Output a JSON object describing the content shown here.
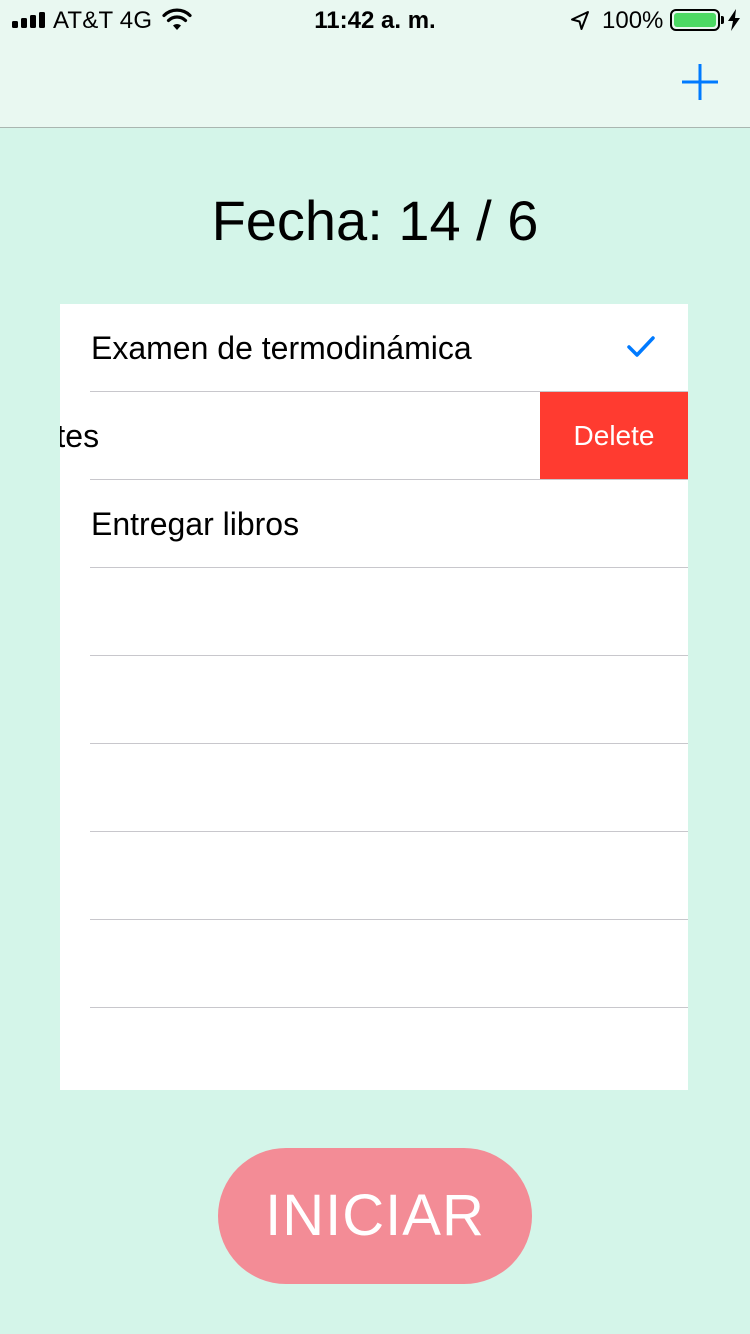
{
  "status_bar": {
    "carrier": "AT&T 4G",
    "time": "11:42 a. m.",
    "battery_percent": "100%",
    "battery_level": 1.0,
    "signal_bars": 4,
    "icons": [
      "signal-icon",
      "wifi-icon",
      "location-arrow-icon",
      "battery-icon",
      "charging-bolt-icon"
    ]
  },
  "nav": {
    "add_icon": "plus-icon",
    "accent_color": "#007aff"
  },
  "header": {
    "title": "Fecha: 14 / 6"
  },
  "tasks": [
    {
      "label": "Examen de termodinámica",
      "checked": true
    },
    {
      "label": "puntes",
      "checked": false,
      "swiped": true
    },
    {
      "label": "Entregar libros",
      "checked": false
    }
  ],
  "row_actions": {
    "delete_label": "Delete",
    "delete_color": "#ff3b30"
  },
  "start_button": {
    "label": "INICIAR",
    "color": "#f38c96"
  },
  "colors": {
    "background": "#d4f5e9",
    "topbar": "#e9f8f1"
  }
}
